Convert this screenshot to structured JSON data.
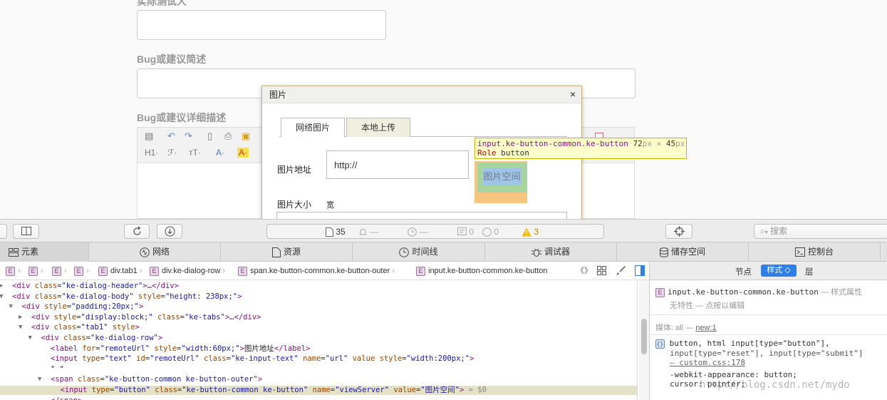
{
  "page": {
    "label_top_cut": "实际测试人",
    "label_summary": "Bug或建议简述",
    "label_detail": "Bug或建议详细描述",
    "editor_tools": [
      "H1·",
      "ℱ·",
      "тT·",
      "A·",
      "A·"
    ]
  },
  "dialog": {
    "title": "图片",
    "close": "×",
    "tabs": [
      "网络图片",
      "本地上传"
    ],
    "url_label": "图片地址",
    "url_value": "http://",
    "size_label": "图片大小",
    "width_label": "宽",
    "server_button": "图片空间"
  },
  "tooltip": {
    "selector": "input.ke-button-common.ke-button",
    "width": "72",
    "height": "45",
    "unit": "px",
    "times": "×",
    "role_label": "Role",
    "role_value": "button"
  },
  "toolbar": {
    "resource_count": "35",
    "dash1": "—",
    "dash2": "—",
    "messages": "0",
    "errors": "0",
    "warnings": "3",
    "search_placeholder": "搜索"
  },
  "panel_tabs": [
    "元素",
    "网络",
    "资源",
    "时间线",
    "调试器",
    "储存空间",
    "控制台"
  ],
  "breadcrumb": [
    "div.tab1",
    "div.ke-dialog-row",
    "span.ke-button-common.ke-button-outer",
    "input.ke-button-common.ke-button"
  ],
  "sidebar": {
    "tabs": [
      "节点",
      "样式 ◇",
      "层"
    ],
    "element": "input.ke-button-common.ke-button",
    "element_suffix": "— 样式属性",
    "no_props": "无特性 — 点按以编辑",
    "media": "媒体: all —",
    "media_link": "new:1",
    "rule_selector": "button, html input[type=\"button\"],",
    "rule_selector2": "input[type=\"reset\"], input[type=\"submit\"]",
    "rule_source": "— custom.css:178",
    "prop1_name": "-webkit-appearance",
    "prop1_value": "button;",
    "prop2_name": "cursor",
    "prop2_value": "pointer;"
  },
  "watermark": "http://blog.csdn.net/mydo",
  "dom_lines": [
    {
      "indent": 0,
      "arrow": "▶",
      "html": "<span class=\"tg\">&lt;div </span><span class=\"an\">class</span>=<span class=\"av\">\"ke-dialog-header\"</span><span class=\"tg\">&gt;</span>…<span class=\"tg\">&lt;/div&gt;</span>"
    },
    {
      "indent": 0,
      "arrow": "▼",
      "html": "<span class=\"tg\">&lt;div </span><span class=\"an\">class</span>=<span class=\"av\">\"ke-dialog-body\"</span> <span class=\"an\">style</span>=<span class=\"av\">\"height: 238px;\"</span><span class=\"tg\">&gt;</span>"
    },
    {
      "indent": 1,
      "arrow": "▼",
      "html": "<span class=\"tg\">&lt;div </span><span class=\"an\">style</span>=<span class=\"av\">\"padding:20px;\"</span><span class=\"tg\">&gt;</span>"
    },
    {
      "indent": 2,
      "arrow": "▶",
      "html": "<span class=\"tg\">&lt;div </span><span class=\"an\">style</span>=<span class=\"av\">\"display:block;\"</span> <span class=\"an\">class</span>=<span class=\"av\">\"ke-tabs\"</span><span class=\"tg\">&gt;</span>…<span class=\"tg\">&lt;/div&gt;</span>"
    },
    {
      "indent": 2,
      "arrow": "▼",
      "html": "<span class=\"tg\">&lt;div </span><span class=\"an\">class</span>=<span class=\"av\">\"tab1\"</span> <span class=\"an\">style</span><span class=\"tg\">&gt;</span>"
    },
    {
      "indent": 3,
      "arrow": "▼",
      "html": "<span class=\"tg\">&lt;div </span><span class=\"an\">class</span>=<span class=\"av\">\"ke-dialog-row\"</span><span class=\"tg\">&gt;</span>"
    },
    {
      "indent": 4,
      "arrow": "",
      "html": "<span class=\"tg\">&lt;label </span><span class=\"an\">for</span>=<span class=\"av\">\"remoteUrl\"</span> <span class=\"an\">style</span>=<span class=\"av\">\"width:60px;\"</span><span class=\"tg\">&gt;</span><span class=\"tx\">图片地址</span><span class=\"tg\">&lt;/label&gt;</span>"
    },
    {
      "indent": 4,
      "arrow": "",
      "html": "<span class=\"tg\">&lt;input </span><span class=\"an\">type</span>=<span class=\"av\">\"text\"</span> <span class=\"an\">id</span>=<span class=\"av\">\"remoteUrl\"</span> <span class=\"an\">class</span>=<span class=\"av\">\"ke-input-text\"</span> <span class=\"an\">name</span>=<span class=\"av\">\"url\"</span> <span class=\"an\">value</span> <span class=\"an\">style</span>=<span class=\"av\">\"width:200px;\"</span><span class=\"tg\">&gt;</span>"
    },
    {
      "indent": 4,
      "arrow": "",
      "html": "<span class=\"tx\">\" \"</span>"
    },
    {
      "indent": 4,
      "arrow": "▼",
      "html": "<span class=\"tg\">&lt;span </span><span class=\"an\">class</span>=<span class=\"av\">\"ke-button-common ke-button-outer\"</span><span class=\"tg\">&gt;</span>"
    },
    {
      "indent": 5,
      "arrow": "",
      "sel": true,
      "html": "<span class=\"tg\">&lt;input </span><span class=\"an\">type</span>=<span class=\"av\">\"button\"</span> <span class=\"an\">class</span>=<span class=\"av\">\"ke-button-common ke-button\"</span> <span class=\"an\">name</span>=<span class=\"av\">\"viewServer\"</span> <span class=\"an\">value</span>=<span class=\"av\">\"图片空间\"</span><span class=\"tg\">&gt;</span> <span style=\"color:#888\">= $0</span>"
    },
    {
      "indent": 4,
      "arrow": "",
      "html": "<span class=\"tg\">&lt;/span&gt;</span>"
    },
    {
      "indent": 4,
      "arrow": "",
      "html": "<span class=\"tx\">\" \"</span>"
    }
  ]
}
